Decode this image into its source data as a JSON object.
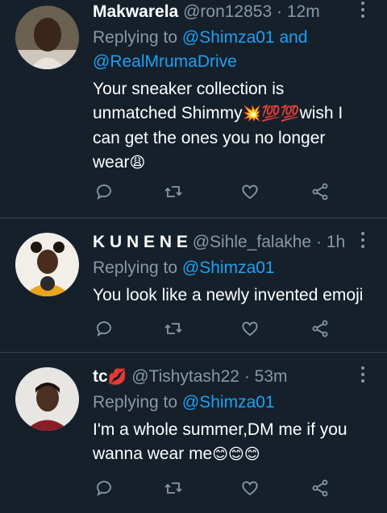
{
  "tweets": [
    {
      "name": "Makwarela",
      "handle": "@ron12853",
      "time": "12m",
      "replying_prefix": "Replying to ",
      "replying_1": "@Shimza01",
      "replying_and": " and",
      "replying_2": "@RealMrumaDrive",
      "text_1": "Your sneaker collection is",
      "text_2": "unmatched Shimmy",
      "text_2_emoji": "💥💯💯",
      "text_2_tail": "wish I",
      "text_3": "can get the ones you no longer",
      "text_4": "wear",
      "text_4_emoji": "😩"
    },
    {
      "name": "K U N E N E",
      "handle": "@Sihle_falakhe",
      "time": "1h",
      "replying_prefix": "Replying to ",
      "replying_1": "@Shimza01",
      "text_1": "You look like a newly invented emoji"
    },
    {
      "name": "tc",
      "name_emoji": "💋",
      "handle": "@Tishytash22",
      "time": "53m",
      "replying_prefix": "Replying to ",
      "replying_1": "@Shimza01",
      "text_1": "I'm a whole summer,DM me if you",
      "text_2": "wanna wear me",
      "text_2_emoji": "😊😊😊"
    }
  ],
  "separator": "·",
  "icons": [
    "reply-icon",
    "retweet-icon",
    "like-icon",
    "share-icon",
    "more-icon"
  ],
  "colors": {
    "background": "#15202b",
    "link": "#1da1f2",
    "muted": "#8899a6",
    "divider": "#38444d"
  }
}
